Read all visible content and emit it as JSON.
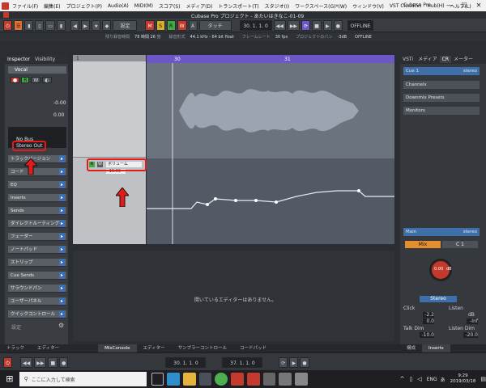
{
  "menubar": {
    "app_icon": "cubase-icon",
    "items": [
      "ファイル(F)",
      "編集(E)",
      "プロジェクト(P)",
      "Audio(A)",
      "MIDI(M)",
      "スコア(S)",
      "メディア(D)",
      "トランスポート(T)",
      "スタジオ(I)",
      "ワークスペース(G)*(W)",
      "ウィンドウ(V)",
      "VST Cloud(V)",
      "Hub(H)",
      "ヘルプ(L)"
    ],
    "window_title": "Cubase Pro",
    "minimize": "—",
    "maximize": "☐",
    "close": "✕"
  },
  "toolbar": {
    "project_title": "Cubase Pro プロジェクト - あたいはきなこ-01-09",
    "offline_label": "OFFLINE",
    "grid_label": "設定",
    "tool_touch": "タッチ",
    "position_display": "30. 1. 1. 0",
    "position_display_2": "37. 1. 1. 0",
    "mute_label": "M",
    "solo_label": "S",
    "read_label": "R",
    "write_label": "W",
    "auto_label": "A"
  },
  "statusbar": {
    "record_time": "残り録音時間",
    "record_time_value": "78 時間 26 分",
    "record_format_label": "録音形式",
    "record_format": "44.1 kHz - 64 bit float",
    "framerate_label": "フレームレート",
    "framerate": "30 fps",
    "pan_label": "プロジェクトのパン",
    "pan": "-3dB",
    "offline": "OFFLINE"
  },
  "inspector": {
    "tab_inspector": "Inspector",
    "tab_visibility": "Visibility",
    "track_name": "Vocal",
    "value_1": "-0.00",
    "value_2": "0.00",
    "routing_in": "No Bus",
    "routing_out": "Stereo Out",
    "sections": [
      "トラックバージョン",
      "コード",
      "EQ",
      "Inserts",
      "Sends",
      "ダイレクトルーティング",
      "フェーダー",
      "ノートパッド",
      "ストリップ",
      "Cue Sends",
      "サラウンドパン",
      "ユーザーパネル",
      "クイックコントロール"
    ],
    "footer": "設定"
  },
  "tracks": {
    "ruler_start": "30",
    "ruler_mid": "31",
    "automation_label": "ボリューム",
    "automation_value": "-15.09",
    "track_number": "1"
  },
  "lower_zone": {
    "message": "開いているエディターはありません。"
  },
  "rightzone": {
    "tabs": [
      "VSTi",
      "メディア",
      "CR",
      "メーター"
    ],
    "cue_label": "Cue 1",
    "cue_type": "stereo",
    "sections": [
      "Channels",
      "Downmix Presets",
      "Monitors"
    ],
    "main_label": "Main",
    "main_type": "stereo",
    "mix_label": "Mix",
    "c1_label": "C 1",
    "knob_value": "0.00",
    "knob_unit": "dB",
    "stereo_label": "Stereo",
    "click_label": "Click",
    "listen_label": "Listen",
    "click_value": "-2.2",
    "listen_value": "dB",
    "click_value_2": "0.0",
    "listen_value_2": "-Inf",
    "talkdim_label": "Talk Dim",
    "listendim_label": "Listen Dim",
    "talkdim_value": "-10.0",
    "listendim_value": "-20.0",
    "footer_1": "構成",
    "footer_2": "Inserts"
  },
  "bottomtabs": [
    "トラック",
    "エディター",
    "MixConsole",
    "エディター",
    "サンプラーコントロール",
    "コードパッド"
  ],
  "taskbar": {
    "search_placeholder": "ここに入力して検索",
    "time": "9:29",
    "date": "2019/03/18",
    "lang": "ENG",
    "ime": "あ"
  },
  "colors": {
    "highlight": "#e41b1b",
    "accent": "#e3702f",
    "waveform": "#9ba4b0"
  }
}
